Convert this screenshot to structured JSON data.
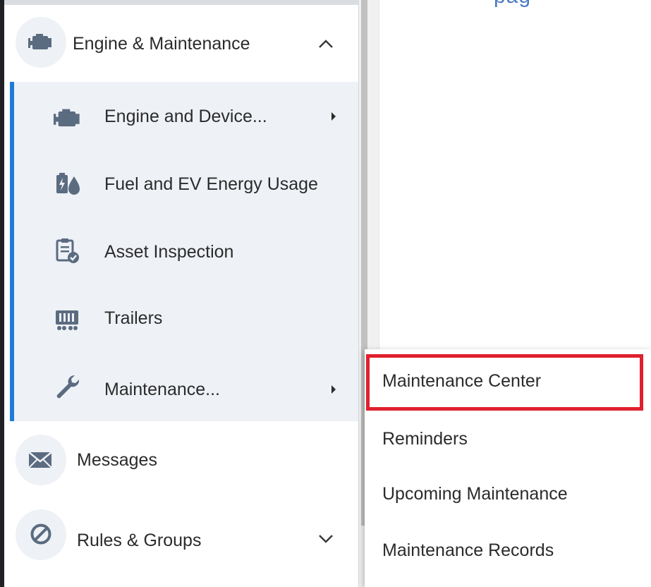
{
  "partial_header_text": "pag",
  "nav": {
    "engine_maintenance": {
      "label": "Engine & Maintenance",
      "icon": "engine-icon",
      "expanded": true
    },
    "messages": {
      "label": "Messages",
      "icon": "envelope-icon"
    },
    "rules_groups": {
      "label": "Rules & Groups",
      "icon": "blocked-circle-icon",
      "expanded": false
    }
  },
  "submenu": {
    "items": [
      {
        "label": "Engine and Device...",
        "icon": "engine-icon",
        "has_submenu": true
      },
      {
        "label": "Fuel and EV Energy Usage",
        "icon": "fuel-ev-icon",
        "has_submenu": false
      },
      {
        "label": "Asset Inspection",
        "icon": "clipboard-check-icon",
        "has_submenu": false
      },
      {
        "label": "Trailers",
        "icon": "trailer-icon",
        "has_submenu": false
      },
      {
        "label": "Maintenance...",
        "icon": "wrench-icon",
        "has_submenu": true
      }
    ]
  },
  "flyout": {
    "items": [
      {
        "label": "Maintenance Center",
        "highlighted": true
      },
      {
        "label": "Reminders"
      },
      {
        "label": "Upcoming Maintenance"
      },
      {
        "label": "Maintenance Records"
      }
    ]
  },
  "colors": {
    "accent": "#1e7bd6",
    "submenu_bg": "#eef1f6",
    "icon": "#5b6b80",
    "highlight_border": "#e0202d"
  }
}
